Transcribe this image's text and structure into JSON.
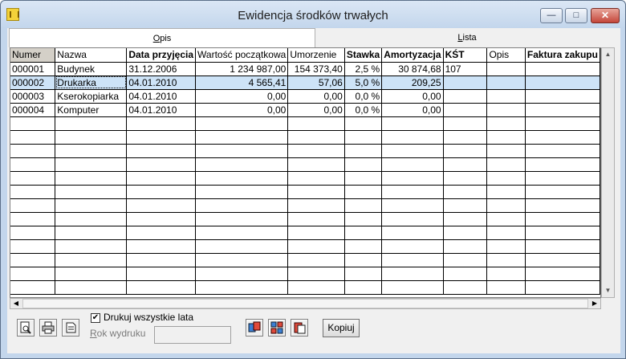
{
  "window": {
    "title": "Ewidencja środków trwałych",
    "min_glyph": "—",
    "max_glyph": "□",
    "close_glyph": "✕"
  },
  "tabs": [
    {
      "label_pre": "",
      "label_u": "O",
      "label_post": "pis"
    },
    {
      "label_pre": "",
      "label_u": "L",
      "label_post": "ista"
    }
  ],
  "grid": {
    "columns": [
      "Numer",
      "Nazwa",
      "Data przyjęcia",
      "Wartość początkowa",
      "Umorzenie",
      "Stawka",
      "Amortyzacja",
      "KŚT",
      "Opis",
      "Faktura zakupu"
    ],
    "rows": [
      [
        "000001",
        "Budynek",
        "31.12.2006",
        "1 234 987,00",
        "154 373,40",
        "2,5 %",
        "30 874,68",
        "107",
        "",
        ""
      ],
      [
        "000002",
        "Drukarka",
        "04.01.2010",
        "4 565,41",
        "57,06",
        "5,0 %",
        "209,25",
        "",
        "",
        ""
      ],
      [
        "000003",
        "Kserokopiarka",
        "04.01.2010",
        "0,00",
        "0,00",
        "0,0 %",
        "0,00",
        "",
        "",
        ""
      ],
      [
        "000004",
        "Komputer",
        "04.01.2010",
        "0,00",
        "0,00",
        "0,0 %",
        "0,00",
        "",
        "",
        ""
      ]
    ],
    "selected_row": 1
  },
  "footer": {
    "print_all_years_label": "Drukuj wszystkie lata",
    "print_all_years_checked": true,
    "year_label_u": "R",
    "year_label_rest": "ok wydruku",
    "year_value": "",
    "copy_button": "Kopiuj"
  },
  "icons": {
    "preview": "print-preview-icon",
    "print": "printer-icon",
    "export": "export-icon",
    "copy_a": "copy-docs-icon",
    "copy_b": "transfer-icon",
    "copy_c": "paste-icon"
  },
  "colors": {
    "title_bar": "#c3d6ec",
    "selection": "#cde3f7",
    "close_button": "#c4463a"
  }
}
